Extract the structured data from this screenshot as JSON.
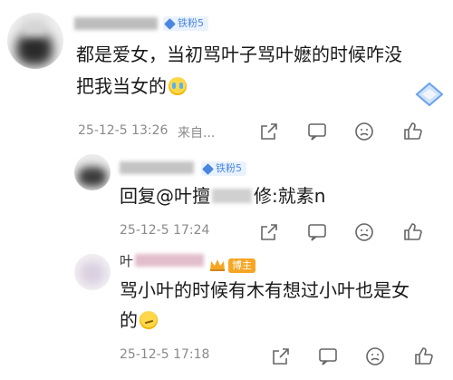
{
  "comments": [
    {
      "badge_label": "铁粉5",
      "text_line1": "都是爱女，当初骂叶子骂叶嬷的时候咋没",
      "text_line2": "把我当女的",
      "timestamp": "25-12-5 13:26",
      "source": "来自...",
      "emoji": "crying-face"
    },
    {
      "badge_label": "铁粉5",
      "reply_prefix": "回复@叶",
      "reply_mid": "擅",
      "reply_suffix": "修:就素n",
      "timestamp": "25-12-5 17:24"
    },
    {
      "author_partial": "叶",
      "host_badge": "博主",
      "text_line1": "骂小叶的时候有木有想过小叶也是女",
      "text_line2": "的",
      "timestamp": "25-12-5 17:18",
      "emoji": "thinking-face"
    }
  ],
  "colors": {
    "badge_blue": "#4a86e0",
    "host_orange": "#f5a623",
    "meta_gray": "#8a8a8a"
  }
}
